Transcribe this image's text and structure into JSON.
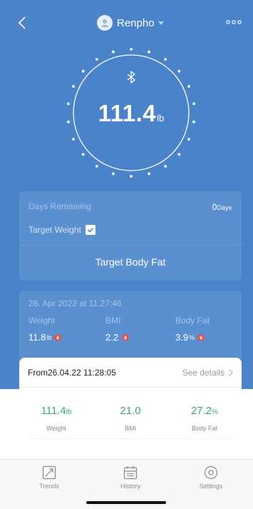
{
  "header": {
    "username": "Renpho"
  },
  "scale": {
    "weight": "111.4",
    "unit": "lb"
  },
  "goal": {
    "days_label": "Days Remaining",
    "days_value": "0",
    "days_unit": "Days",
    "target_weight_label": "Target Weight",
    "target_body_fat_label": "Target Body Fat"
  },
  "last_measure": {
    "datetime": "26. Apr 2022 at 11:27:46",
    "metrics": [
      {
        "label": "Weight",
        "value": "11.8",
        "unit": "lb"
      },
      {
        "label": "BMI",
        "value": "2.2",
        "unit": ""
      },
      {
        "label": "Body Fat",
        "value": "3.9",
        "unit": "%"
      }
    ]
  },
  "summary": {
    "from_label": "From26.04.22  11:28:05",
    "see_details": "See details",
    "stats": [
      {
        "value": "111.4",
        "unit": "lb",
        "label": "Weight"
      },
      {
        "value": "21.0",
        "unit": "",
        "label": "BMI"
      },
      {
        "value": "27.2",
        "unit": "%",
        "label": "Body Fat"
      }
    ]
  },
  "tabs": [
    {
      "label": "Trends"
    },
    {
      "label": "History"
    },
    {
      "label": "Settings"
    }
  ],
  "colors": {
    "primary": "#4a83c9",
    "card": "#5a8fd0",
    "accent_green": "#3fa86c",
    "increase_red": "#e35353"
  }
}
